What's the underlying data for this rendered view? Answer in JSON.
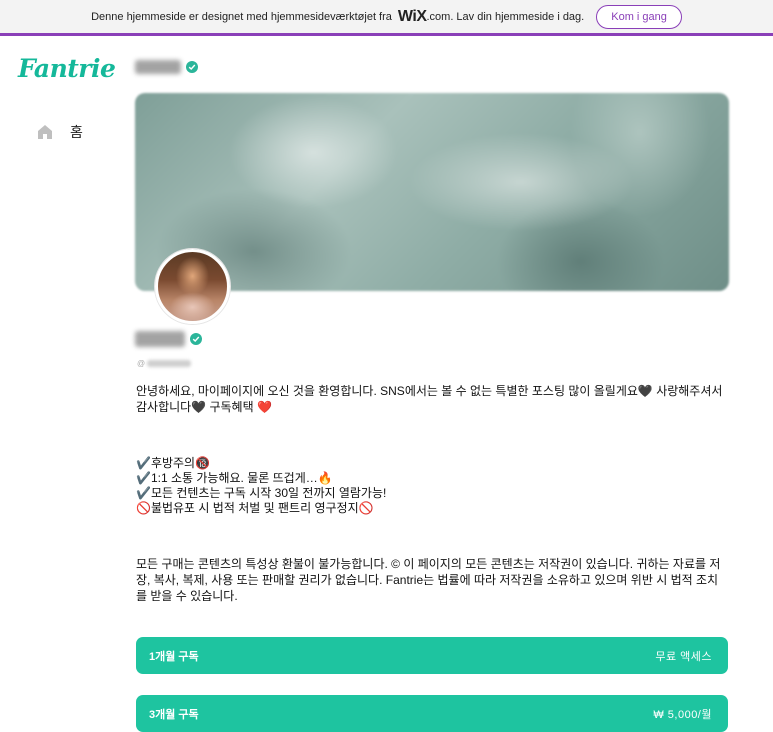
{
  "wix_banner": {
    "text_before": "Denne hjemmeside er designet med hjemmesideværktøjet fra",
    "logo": "WiX",
    "text_after": ".com. Lav din hjemmeside i dag.",
    "button_label": "Kom i gang",
    "accent_color": "#8a3fb8"
  },
  "sidebar": {
    "brand": "Fantrie",
    "brand_color": "#15b89a",
    "nav_items": [
      {
        "label": "홈",
        "icon": "home-icon"
      }
    ]
  },
  "profile": {
    "verified_icon": "verified-check-icon",
    "verified_color": "#2bb59a",
    "handle_prefix": "@"
  },
  "bio": {
    "intro": "안녕하세요, 마이페이지에 오신 것을 환영합니다. SNS에서는 볼 수 없는 특별한 포스팅 많이 올릴게요🖤 사랑해주셔서 감사합니다🖤 구독혜택 ❤️",
    "list": [
      "✔️후방주의🔞",
      "✔️1:1 소통 가능해요. 물론 뜨겁게…🔥",
      "✔️모든 컨텐츠는 구독 시작 30일 전까지 열람가능!",
      "🚫불법유포 시 법적 처벌 및 팬트리 영구정지🚫"
    ],
    "notice": "모든 구매는 콘텐츠의 특성상 환불이 불가능합니다. © 이 페이지의 모든 콘텐츠는 저작권이 있습니다. 귀하는 자료를 저장, 복사, 복제, 사용 또는 판매할 권리가 없습니다. Fantrie는 법률에 따라 저작권을 소유하고 있으며 위반 시 법적 조치를 받을 수 있습니다."
  },
  "subscriptions": [
    {
      "label": "1개월 구독",
      "price": "무료 액세스"
    },
    {
      "label": "3개월 구독",
      "price": "₩ 5,000/월"
    }
  ],
  "subscription_color": "#1ec4a0"
}
